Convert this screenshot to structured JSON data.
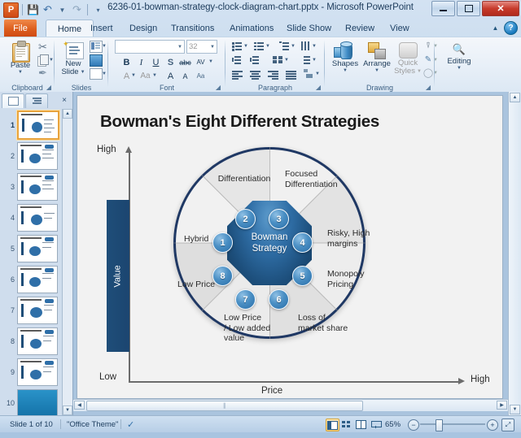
{
  "window": {
    "title": "6236-01-bowman-strategy-clock-diagram-chart.pptx  -  Microsoft PowerPoint",
    "app_logo": "P",
    "minimize_label": "Minimize",
    "maximize_label": "Maximize",
    "close_label": "Close"
  },
  "quick_access": {
    "save_label": "Save",
    "undo_label": "Undo",
    "redo_label": "Redo",
    "customize_label": "Customize Quick Access Toolbar"
  },
  "ribbon": {
    "tabs": [
      {
        "label": "File"
      },
      {
        "label": "Home"
      },
      {
        "label": "Insert"
      },
      {
        "label": "Design"
      },
      {
        "label": "Transitions"
      },
      {
        "label": "Animations"
      },
      {
        "label": "Slide Show"
      },
      {
        "label": "Review"
      },
      {
        "label": "View"
      }
    ],
    "help_label": "?",
    "collapse_label": "Minimize the Ribbon",
    "groups": {
      "clipboard": {
        "label": "Clipboard",
        "paste_label": "Paste",
        "cut_label": "Cut",
        "copy_label": "Copy",
        "format_painter_label": "Format Painter",
        "dialog_label": "Clipboard dialog launcher"
      },
      "slides": {
        "label": "Slides",
        "new_slide_label": "New\nSlide",
        "new_slide_line1": "New",
        "new_slide_line2": "Slide",
        "layout_label": "Layout",
        "reset_label": "Reset",
        "section_label": "Section"
      },
      "font": {
        "label": "Font",
        "font_name_value": "",
        "font_name_placeholder": "",
        "font_size_value": "32",
        "bold_label": "B",
        "italic_label": "I",
        "underline_label": "U",
        "shadow_label": "S",
        "strikethrough_label": "abc",
        "character_spacing_label": "AV",
        "font_color_label": "A",
        "change_case_label": "Aa",
        "grow_font_label": "A",
        "shrink_font_label": "A",
        "clear_formatting_label": "Aa",
        "dialog_label": "Font dialog launcher"
      },
      "paragraph": {
        "label": "Paragraph",
        "bullets_label": "Bullets",
        "numbering_label": "Numbering",
        "line_spacing_label": "Line Spacing",
        "text_direction_label": "Text Direction",
        "decrease_indent_label": "Decrease List Level",
        "increase_indent_label": "Increase List Level",
        "columns_label": "Columns",
        "align_text_label": "Align Text",
        "align_left_label": "Align Left",
        "center_label": "Center",
        "align_right_label": "Align Right",
        "justify_label": "Justify",
        "smartart_label": "Convert to SmartArt",
        "dialog_label": "Paragraph dialog launcher"
      },
      "drawing": {
        "label": "Drawing",
        "shapes_label": "Shapes",
        "arrange_label": "Arrange",
        "quick_styles_line1": "Quick",
        "quick_styles_line2": "Styles",
        "shape_fill_label": "Shape Fill",
        "shape_outline_label": "Shape Outline",
        "shape_effects_label": "Shape Effects",
        "dialog_label": "Format Shape dialog launcher"
      },
      "editing": {
        "label": "",
        "editing_label": "Editing"
      }
    }
  },
  "left_pane": {
    "slides_tab_label": "Slides",
    "outline_tab_label": "Outline",
    "close_label": "×",
    "scroll_up_label": "▲",
    "scroll_down_label": "▼",
    "thumbnails": [
      {
        "number": "1",
        "selected": true,
        "style": "chart"
      },
      {
        "number": "2",
        "selected": false,
        "style": "chart"
      },
      {
        "number": "3",
        "selected": false,
        "style": "chart"
      },
      {
        "number": "4",
        "selected": false,
        "style": "chart"
      },
      {
        "number": "5",
        "selected": false,
        "style": "chart"
      },
      {
        "number": "6",
        "selected": false,
        "style": "chart"
      },
      {
        "number": "7",
        "selected": false,
        "style": "chart"
      },
      {
        "number": "8",
        "selected": false,
        "style": "chart"
      },
      {
        "number": "9",
        "selected": false,
        "style": "chart"
      },
      {
        "number": "10",
        "selected": false,
        "style": "solid"
      }
    ]
  },
  "slide": {
    "title": "Bowman's Eight Different Strategies",
    "center_line1": "Bowman",
    "center_line2": "Strategy",
    "axes": {
      "y_axis_label": "Value",
      "y_high_label": "High",
      "y_low_label": "Low",
      "x_axis_label": "Price",
      "x_high_label": "High"
    },
    "segments": [
      {
        "number": "1",
        "label": "Hybrid"
      },
      {
        "number": "2",
        "label": "Differentiation"
      },
      {
        "number": "3",
        "label": "Focused\nDifferentiation"
      },
      {
        "number": "4",
        "label": "Risky, High\nmargins"
      },
      {
        "number": "5",
        "label": "Monopoly\nPricing"
      },
      {
        "number": "6",
        "label": "Loss of\nmarket share"
      },
      {
        "number": "7",
        "label": "Low Price\n/ Low added\nvalue"
      },
      {
        "number": "8",
        "label": "Low Price"
      }
    ],
    "labels": {
      "differentiation": "Differentiation",
      "focused_differentiation_l1": "Focused",
      "focused_differentiation_l2": "Differentiation",
      "hybrid": "Hybrid",
      "risky_high_margins_l1": "Risky, High",
      "risky_high_margins_l2": "margins",
      "monopoly_pricing_l1": "Monopoly",
      "monopoly_pricing_l2": "Pricing",
      "low_price": "Low Price",
      "low_price_low_added_l1": "Low Price",
      "low_price_low_added_l2": "/ Low added",
      "low_price_low_added_l3": "value",
      "loss_of_market_share_l1": "Loss of",
      "loss_of_market_share_l2": "market share"
    },
    "node_numbers": [
      "1",
      "2",
      "3",
      "4",
      "5",
      "6",
      "7",
      "8"
    ]
  },
  "status_bar": {
    "slide_counter": "Slide 1 of 10",
    "theme": "\"Office Theme\"",
    "spellcheck_label": "Spelling check",
    "views": [
      {
        "name": "normal",
        "label": "Normal",
        "selected": true
      },
      {
        "name": "slide-sorter",
        "label": "Slide Sorter",
        "selected": false
      },
      {
        "name": "reading",
        "label": "Reading View",
        "selected": false
      },
      {
        "name": "slide-show",
        "label": "Slide Show",
        "selected": false
      }
    ],
    "zoom_level": "65%",
    "zoom_out_label": "−",
    "zoom_in_label": "+",
    "fit_label": "Fit slide to current window"
  },
  "colors": {
    "accent_blue": "#1f4e79",
    "node_blue": "#2a6ea8",
    "ring_navy": "#1f3864",
    "file_orange": "#dd5f1e",
    "selected_thumb": "#e8a33d"
  }
}
